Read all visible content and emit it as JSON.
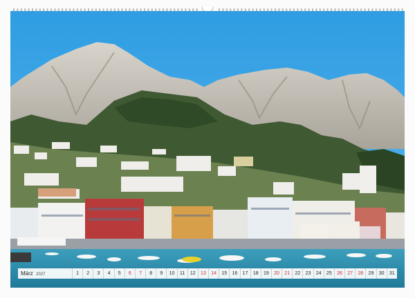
{
  "calendar": {
    "month": "März",
    "year": "2027",
    "days": [
      {
        "n": "1",
        "we": false
      },
      {
        "n": "2",
        "we": false
      },
      {
        "n": "3",
        "we": false
      },
      {
        "n": "4",
        "we": false
      },
      {
        "n": "5",
        "we": false
      },
      {
        "n": "6",
        "we": true
      },
      {
        "n": "7",
        "we": true
      },
      {
        "n": "8",
        "we": false
      },
      {
        "n": "9",
        "we": false
      },
      {
        "n": "10",
        "we": false
      },
      {
        "n": "11",
        "we": false
      },
      {
        "n": "12",
        "we": false
      },
      {
        "n": "13",
        "we": true
      },
      {
        "n": "14",
        "we": true
      },
      {
        "n": "15",
        "we": false
      },
      {
        "n": "16",
        "we": false
      },
      {
        "n": "17",
        "we": false
      },
      {
        "n": "18",
        "we": false
      },
      {
        "n": "19",
        "we": false
      },
      {
        "n": "20",
        "we": true
      },
      {
        "n": "21",
        "we": true
      },
      {
        "n": "22",
        "we": false
      },
      {
        "n": "23",
        "we": false
      },
      {
        "n": "24",
        "we": false
      },
      {
        "n": "25",
        "we": false
      },
      {
        "n": "26",
        "we": true
      },
      {
        "n": "27",
        "we": true
      },
      {
        "n": "28",
        "we": true
      },
      {
        "n": "29",
        "we": false
      },
      {
        "n": "30",
        "we": false
      },
      {
        "n": "31",
        "we": false
      }
    ]
  },
  "colors": {
    "sky": "#3aa6e6",
    "weekend": "#d9262b",
    "sea": "#2c8fb0"
  }
}
